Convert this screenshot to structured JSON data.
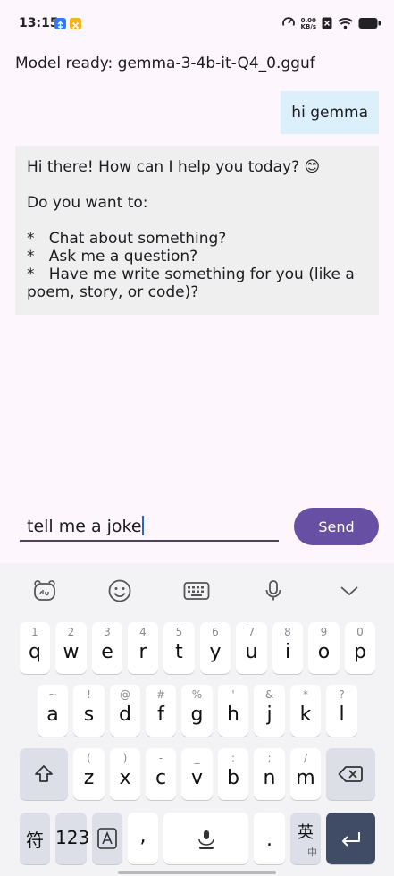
{
  "status_bar": {
    "time": "13:15",
    "net_speed_value": "0.00",
    "net_speed_unit": "KB/s",
    "icons": [
      "usb-debug-icon",
      "app-notification-icon",
      "speedometer-icon",
      "no-sim-icon",
      "wifi-icon",
      "battery-icon"
    ]
  },
  "chat": {
    "model_status": "Model ready: gemma-3-4b-it-Q4_0.gguf",
    "user_message": "hi gemma",
    "bot_lines": {
      "greeting": "Hi there! How can I help you today? 😊",
      "prompt": "Do you want to:",
      "option1": "*   Chat about something?",
      "option2": "*   Ask me a question?",
      "option3a": "*   Have me write something for you (like a",
      "option3b": "poem, story, or code)?"
    }
  },
  "composer": {
    "input_value": "tell me a joke",
    "send_label": "Send"
  },
  "keyboard": {
    "toolbar": [
      "du-logo-icon",
      "emoji-icon",
      "keyboard-icon",
      "microphone-icon",
      "chevron-down-icon"
    ],
    "row1": [
      {
        "main": "q",
        "sub": "1"
      },
      {
        "main": "w",
        "sub": "2"
      },
      {
        "main": "e",
        "sub": "3"
      },
      {
        "main": "r",
        "sub": "4"
      },
      {
        "main": "t",
        "sub": "5"
      },
      {
        "main": "y",
        "sub": "6"
      },
      {
        "main": "u",
        "sub": "7"
      },
      {
        "main": "i",
        "sub": "8"
      },
      {
        "main": "o",
        "sub": "9"
      },
      {
        "main": "p",
        "sub": "0"
      }
    ],
    "row2": [
      {
        "main": "a",
        "sub": "~"
      },
      {
        "main": "s",
        "sub": "!"
      },
      {
        "main": "d",
        "sub": "@"
      },
      {
        "main": "f",
        "sub": "#"
      },
      {
        "main": "g",
        "sub": "%"
      },
      {
        "main": "h",
        "sub": "'"
      },
      {
        "main": "j",
        "sub": "&"
      },
      {
        "main": "k",
        "sub": "*"
      },
      {
        "main": "l",
        "sub": "?"
      }
    ],
    "row3": [
      {
        "main": "z",
        "sub": "("
      },
      {
        "main": "x",
        "sub": ")"
      },
      {
        "main": "c",
        "sub": "-"
      },
      {
        "main": "v",
        "sub": "_"
      },
      {
        "main": "b",
        "sub": ":"
      },
      {
        "main": "n",
        "sub": ";"
      },
      {
        "main": "m",
        "sub": "/"
      }
    ],
    "symbols_label": "符",
    "numbers_label": "123",
    "comma_label": ",",
    "period_label": ".",
    "lang_label": "英",
    "lang_sub": "中"
  }
}
